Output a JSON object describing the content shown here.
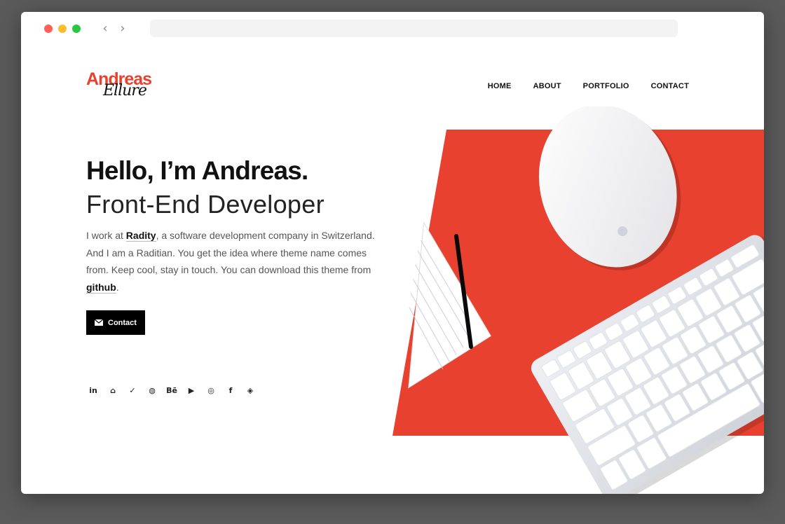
{
  "browser": {
    "back_glyph": "‹",
    "forward_glyph": "›",
    "url": ""
  },
  "logo": {
    "first": "Andreas",
    "second": "Ellure"
  },
  "nav": {
    "items": [
      {
        "label": "HOME"
      },
      {
        "label": "ABOUT"
      },
      {
        "label": "PORTFOLIO"
      },
      {
        "label": "CONTACT"
      }
    ]
  },
  "hero": {
    "title": "Hello, I’m Andreas.",
    "subtitle": "Front-End Developer",
    "text_before_link1": "I work at ",
    "link1": "Radity",
    "text_after_link1": ", a software development company in Switzerland. And I am a Raditian. You get the idea where theme name comes from. Keep cool, stay in touch. You can download this theme from ",
    "link2": "github",
    "text_end": ".",
    "button_label": "Contact"
  },
  "socials": [
    {
      "name": "linkedin-icon",
      "glyph": "in"
    },
    {
      "name": "github-icon",
      "glyph": "⌂"
    },
    {
      "name": "twitter-icon",
      "glyph": "✓"
    },
    {
      "name": "dribbble-icon",
      "glyph": "◍"
    },
    {
      "name": "behance-icon",
      "glyph": "Bē"
    },
    {
      "name": "youtube-icon",
      "glyph": "▶"
    },
    {
      "name": "instagram-icon",
      "glyph": "◎"
    },
    {
      "name": "facebook-icon",
      "glyph": "f"
    },
    {
      "name": "codepen-icon",
      "glyph": "◈"
    }
  ],
  "colors": {
    "accent": "#e8412f",
    "dark": "#111111"
  }
}
